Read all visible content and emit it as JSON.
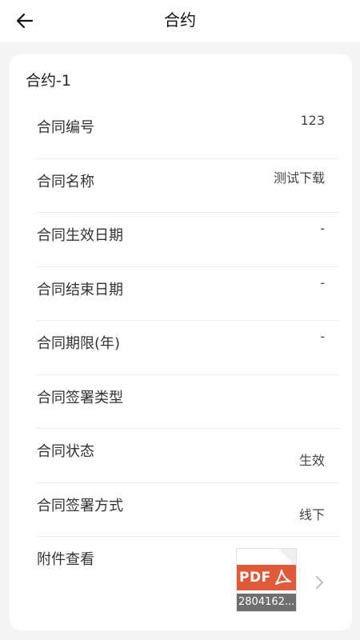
{
  "header": {
    "title": "合约"
  },
  "card": {
    "title": "合约-1",
    "rows": [
      {
        "label": "合同编号",
        "value": "123"
      },
      {
        "label": "合同名称",
        "value": "测试下载"
      },
      {
        "label": "合同生效日期",
        "value": "-"
      },
      {
        "label": "合同结束日期",
        "value": "-"
      },
      {
        "label": "合同期限(年)",
        "value": "-"
      },
      {
        "label": "合同签署类型",
        "value": ""
      },
      {
        "label": "合同状态",
        "value": "生效"
      },
      {
        "label": "合同签署方式",
        "value": "线下"
      }
    ],
    "attachment": {
      "label": "附件查看",
      "file_type": "PDF",
      "file_name": "2804162..."
    }
  },
  "icons": {
    "back": "arrow-left-icon",
    "pdf": "pdf-file-icon",
    "chevron": "chevron-right-icon"
  },
  "colors": {
    "pdf_red": "#e05a3a",
    "background": "#f4f4f4"
  }
}
